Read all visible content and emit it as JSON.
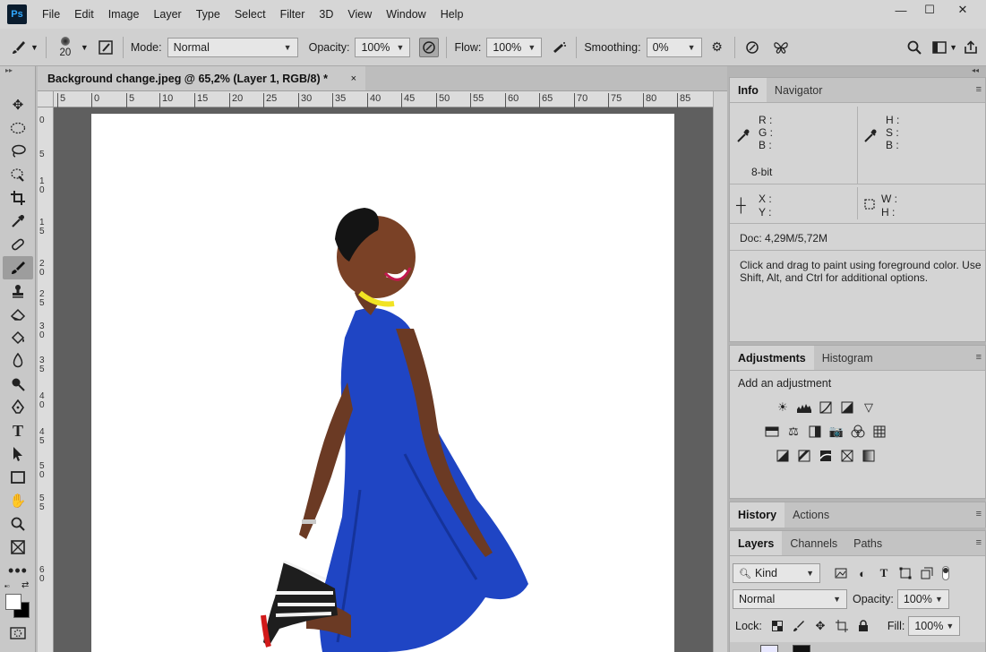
{
  "menubar": {
    "logo": "Ps",
    "items": [
      "File",
      "Edit",
      "Image",
      "Layer",
      "Type",
      "Select",
      "Filter",
      "3D",
      "View",
      "Window",
      "Help"
    ],
    "window_controls": {
      "minimize": "—",
      "maximize": "☐",
      "close": "✕"
    }
  },
  "options": {
    "brush_size": "20",
    "mode_label": "Mode:",
    "mode_value": "Normal",
    "opacity_label": "Opacity:",
    "opacity_value": "100%",
    "flow_label": "Flow:",
    "flow_value": "100%",
    "smoothing_label": "Smoothing:",
    "smoothing_value": "0%"
  },
  "document": {
    "tab_title": "Background change.jpeg @ 65,2% (Layer 1, RGB/8) *",
    "close": "×"
  },
  "rulers": {
    "horizontal": [
      "5",
      "0",
      "5",
      "10",
      "15",
      "20",
      "25",
      "30",
      "35",
      "40",
      "45",
      "50",
      "55",
      "60",
      "65",
      "70",
      "75",
      "80",
      "85"
    ],
    "vertical": [
      "0",
      "5",
      "1\n0",
      "1\n5",
      "2\n0",
      "2\n5",
      "3\n0",
      "3\n5",
      "4\n0",
      "4\n5",
      "5\n0",
      "5\n5",
      "6\n0"
    ]
  },
  "panels": {
    "info_tabs": [
      "Info",
      "Navigator"
    ],
    "info": {
      "rgb": [
        "R :",
        "G :",
        "B :"
      ],
      "hsb": [
        "H :",
        "S :",
        "B :"
      ],
      "bit": "8-bit",
      "xy": [
        "X :",
        "Y :"
      ],
      "wh": [
        "W :",
        "H :"
      ],
      "doc": "Doc: 4,29M/5,72M",
      "hint": "Click and drag to paint using foreground color.  Use Shift, Alt, and Ctrl for additional options."
    },
    "adjust_tabs": [
      "Adjustments",
      "Histogram"
    ],
    "adjust_prompt": "Add an adjustment",
    "history_tabs": [
      "History",
      "Actions"
    ],
    "layers_tabs": [
      "Layers",
      "Channels",
      "Paths"
    ],
    "layers": {
      "kind": "Kind",
      "blend": "Normal",
      "opacity_label": "Opacity:",
      "opacity_value": "100%",
      "lock_label": "Lock:",
      "fill_label": "Fill:",
      "fill_value": "100%"
    }
  },
  "colors": {
    "dress_blue": "#1f45c4",
    "skin": "#6b3a24",
    "accent_yellow": "#f1e323",
    "shoe_red": "#d11a1a"
  }
}
